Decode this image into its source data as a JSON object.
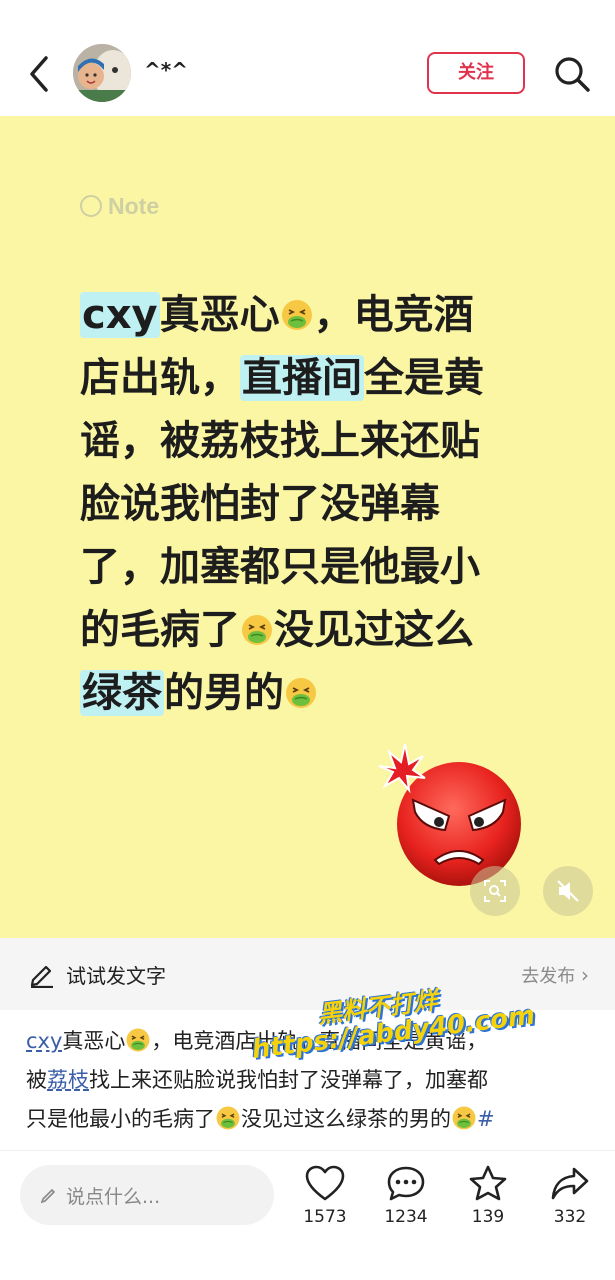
{
  "header": {
    "username": "^*^",
    "follow_label": "关注"
  },
  "note": {
    "badge": "Note",
    "lines": [
      {
        "segments": [
          {
            "t": "cxy",
            "hl": true
          },
          {
            "t": "真恶心"
          },
          {
            "emoji": "nauseated-face"
          },
          {
            "t": "，电竞酒"
          }
        ]
      },
      {
        "segments": [
          {
            "t": "店出轨，"
          },
          {
            "t": "直播间",
            "hl": true
          },
          {
            "t": "全是黄"
          }
        ]
      },
      {
        "segments": [
          {
            "t": "谣，被荔枝找上来还贴"
          }
        ]
      },
      {
        "segments": [
          {
            "t": "脸说我怕封了没弹幕"
          }
        ]
      },
      {
        "segments": [
          {
            "t": "了，加塞都只是他最小"
          }
        ]
      },
      {
        "segments": [
          {
            "t": "的毛病了"
          },
          {
            "emoji": "nauseated-face"
          },
          {
            "t": "没见过这么"
          }
        ]
      },
      {
        "segments": [
          {
            "t": "绿茶",
            "hl": true
          },
          {
            "t": "的男的"
          },
          {
            "emoji": "nauseated-face"
          }
        ]
      }
    ],
    "sticker": "angry-face"
  },
  "write_bar": {
    "label": "试试发文字",
    "publish": "去发布"
  },
  "description": {
    "lines": [
      [
        {
          "t": "cxy",
          "tag": true
        },
        {
          "t": "真恶心"
        },
        {
          "emoji": "nauseated-face"
        },
        {
          "t": "，电竞酒店出轨，直播间全是黄谣，"
        }
      ],
      [
        {
          "t": "被"
        },
        {
          "t": "荔枝",
          "tag": true
        },
        {
          "t": "找上来还贴脸说我怕封了没弹幕了，加塞都"
        }
      ],
      [
        {
          "t": "只是他最小的毛病了"
        },
        {
          "emoji": "nauseated-face"
        },
        {
          "t": "没见过这么绿茶的男的"
        },
        {
          "emoji": "nauseated-face"
        },
        {
          "t": "#",
          "hash": true
        }
      ]
    ]
  },
  "watermark": {
    "line1": "黑料不打烊",
    "line2": "https://abdy40.com"
  },
  "bottom_bar": {
    "comment_placeholder": "说点什么...",
    "likes": "1573",
    "comments": "1234",
    "favorites": "139",
    "shares": "332"
  },
  "colors": {
    "note_bg": "#fbf6a3",
    "highlight": "#bff0f2",
    "follow_accent": "#e0344e",
    "tag_blue": "#3a5ea8"
  }
}
